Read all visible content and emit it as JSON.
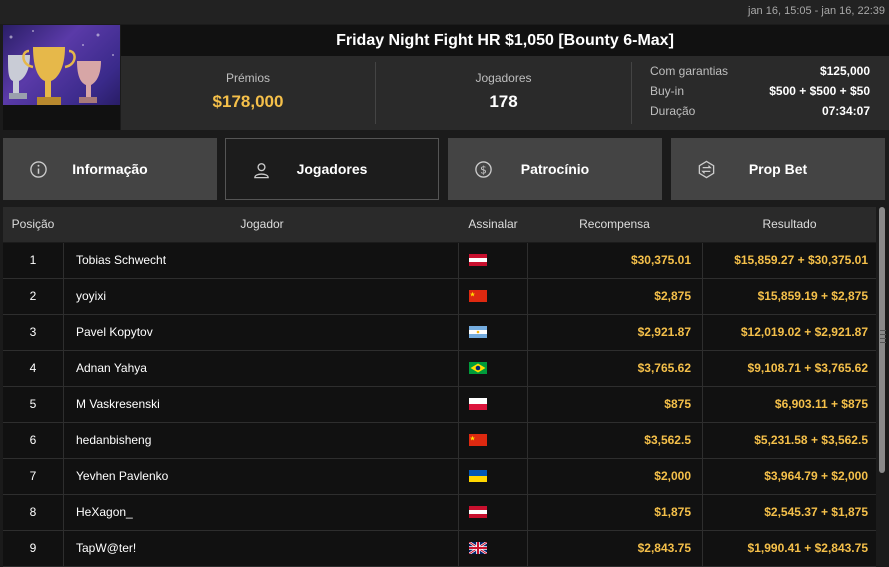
{
  "header": {
    "dates": "jan 16, 15:05 - jan 16, 22:39",
    "title": "Friday Night Fight HR $1,050 [Bounty 6-Max]"
  },
  "stats": {
    "prizes_label": "Prémios",
    "prizes_value": "$178,000",
    "players_label": "Jogadores",
    "players_value": "178",
    "details": [
      {
        "label": "Com garantias",
        "value": "$125,000"
      },
      {
        "label": "Buy-in",
        "value": "$500 + $500 + $50"
      },
      {
        "label": "Duração",
        "value": "07:34:07"
      }
    ]
  },
  "tabs": [
    {
      "label": "Informação",
      "icon": "info-icon"
    },
    {
      "label": "Jogadores",
      "icon": "user-icon",
      "active": true
    },
    {
      "label": "Patrocínio",
      "icon": "dollar-coin-icon"
    },
    {
      "label": "Prop Bet",
      "icon": "prop-bet-icon"
    }
  ],
  "table": {
    "headers": {
      "position": "Posição",
      "player": "Jogador",
      "flag": "Assinalar",
      "reward": "Recompensa",
      "result": "Resultado"
    },
    "rows": [
      {
        "pos": "1",
        "name": "Tobias Schwecht",
        "flag": "austria",
        "reward": "$30,375.01",
        "result": "$15,859.27 + $30,375.01"
      },
      {
        "pos": "2",
        "name": "yoyixi",
        "flag": "china",
        "reward": "$2,875",
        "result": "$15,859.19 + $2,875"
      },
      {
        "pos": "3",
        "name": "Pavel Kopytov",
        "flag": "argentina",
        "reward": "$2,921.87",
        "result": "$12,019.02 + $2,921.87"
      },
      {
        "pos": "4",
        "name": "Adnan Yahya",
        "flag": "brazil",
        "reward": "$3,765.62",
        "result": "$9,108.71 + $3,765.62"
      },
      {
        "pos": "5",
        "name": "M Vaskresenski",
        "flag": "poland",
        "reward": "$875",
        "result": "$6,903.11 + $875"
      },
      {
        "pos": "6",
        "name": "hedanbisheng",
        "flag": "china",
        "reward": "$3,562.5",
        "result": "$5,231.58 + $3,562.5"
      },
      {
        "pos": "7",
        "name": "Yevhen Pavlenko",
        "flag": "ukraine",
        "reward": "$2,000",
        "result": "$3,964.79 + $2,000"
      },
      {
        "pos": "8",
        "name": "HeXagon_",
        "flag": "austria",
        "reward": "$1,875",
        "result": "$2,545.37 + $1,875"
      },
      {
        "pos": "9",
        "name": "TapW@ter!",
        "flag": "uk",
        "reward": "$2,843.75",
        "result": "$1,990.41 + $2,843.75"
      }
    ]
  },
  "colors": {
    "gold": "#f5c04a",
    "tab_bg": "#444444",
    "row_bg": "#111111"
  }
}
